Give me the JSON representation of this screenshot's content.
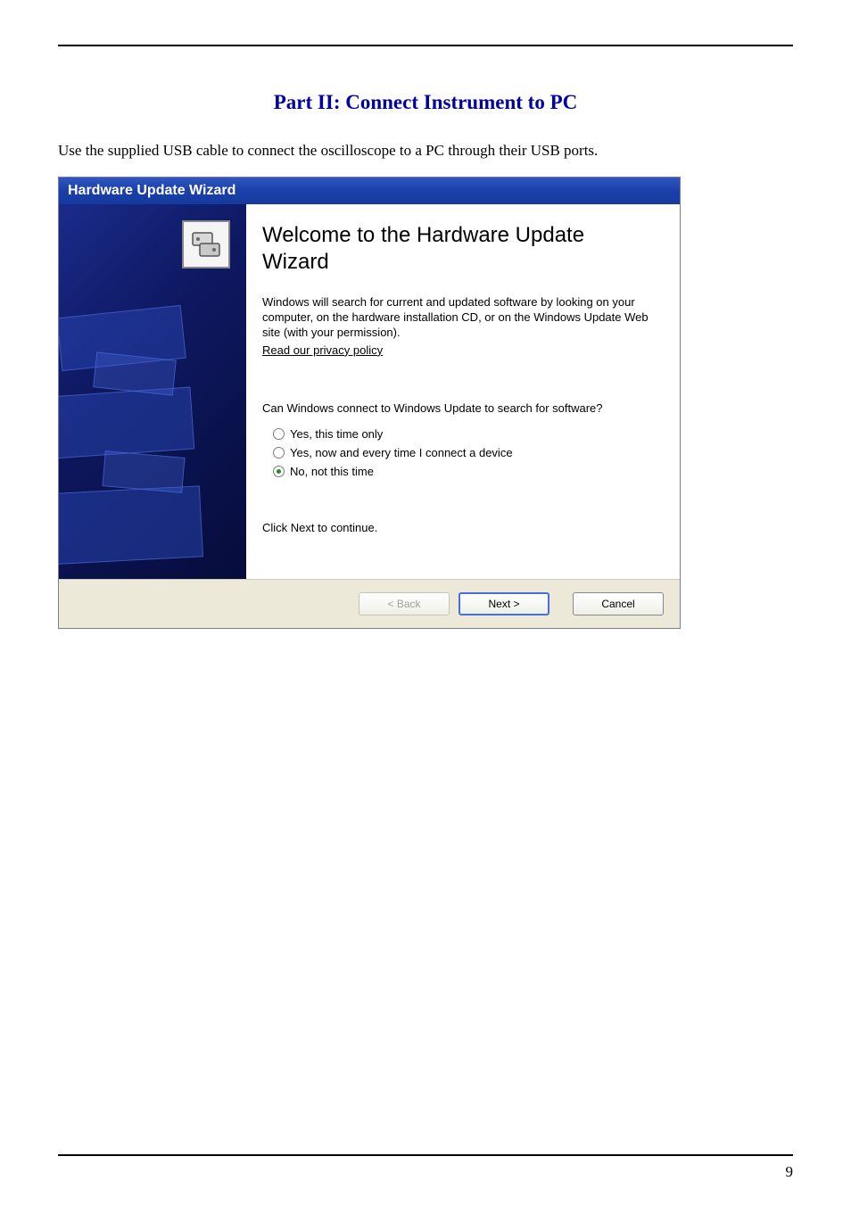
{
  "doc": {
    "title": "Part II: Connect Instrument to PC",
    "intro": "Use the supplied USB cable to connect the oscilloscope to a PC through their USB ports.",
    "page_number": "9"
  },
  "wizard": {
    "titlebar": "Hardware Update Wizard",
    "heading": "Welcome to the Hardware Update Wizard",
    "description": "Windows will search for current and updated software by looking on your computer, on the hardware installation CD, or on the Windows Update Web site (with your permission).",
    "privacy_link": "Read our privacy policy",
    "question": "Can Windows connect to Windows Update to search for software?",
    "options": {
      "opt1": "Yes, this time only",
      "opt2": "Yes, now and every time I connect a device",
      "opt3": "No, not this time"
    },
    "selected": "opt3",
    "continue_text": "Click Next to continue.",
    "buttons": {
      "back": "< Back",
      "next": "Next >",
      "cancel": "Cancel"
    }
  }
}
